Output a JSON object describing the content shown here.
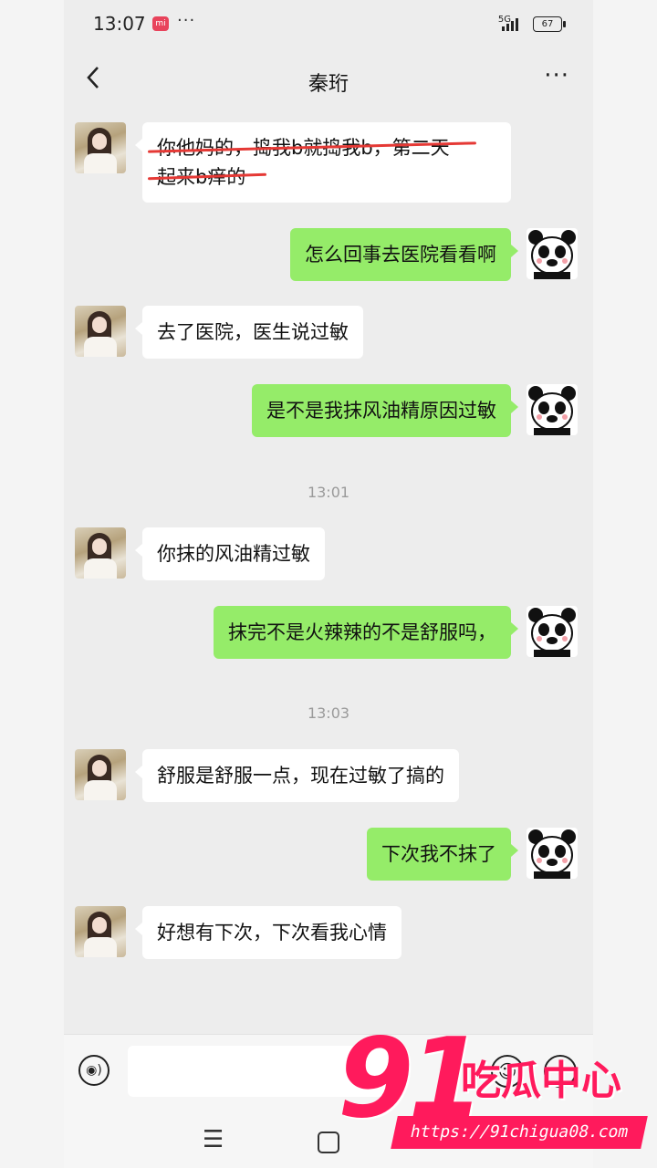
{
  "status": {
    "time": "13:07",
    "network": "5G",
    "battery": "67"
  },
  "header": {
    "title": "秦珩",
    "back_icon": "chevron-left-icon",
    "more_label": "···"
  },
  "messages": [
    {
      "side": "left",
      "lines": [
        "你他妈的，捣我b就捣我b，第二天",
        "起来b痒的"
      ],
      "struck": true
    },
    {
      "side": "right",
      "text": "怎么回事去医院看看啊"
    },
    {
      "side": "left",
      "text": "去了医院，医生说过敏"
    },
    {
      "side": "right",
      "text": "是不是我抹风油精原因过敏"
    },
    {
      "side": "left",
      "text": "你抹的风油精过敏"
    },
    {
      "side": "right",
      "text": "抹完不是火辣辣的不是舒服吗，"
    },
    {
      "side": "left",
      "text": "舒服是舒服一点，现在过敏了搞的"
    },
    {
      "side": "right",
      "text": "下次我不抹了"
    },
    {
      "side": "left",
      "text": "好想有下次，下次看我心情"
    }
  ],
  "timestamps": [
    "13:01",
    "13:03"
  ],
  "input": {
    "voice_icon": "voice-icon",
    "emoji_icon": "emoji-icon",
    "plus_icon": "plus-icon"
  },
  "watermark": {
    "number": "91",
    "text": "吃瓜中心",
    "url": "https://91chigua08.com"
  },
  "colors": {
    "green_bubble": "#95ec69",
    "white_bubble": "#ffffff",
    "background": "#ededed",
    "watermark": "#ff1a5c",
    "strike": "#e53935"
  }
}
